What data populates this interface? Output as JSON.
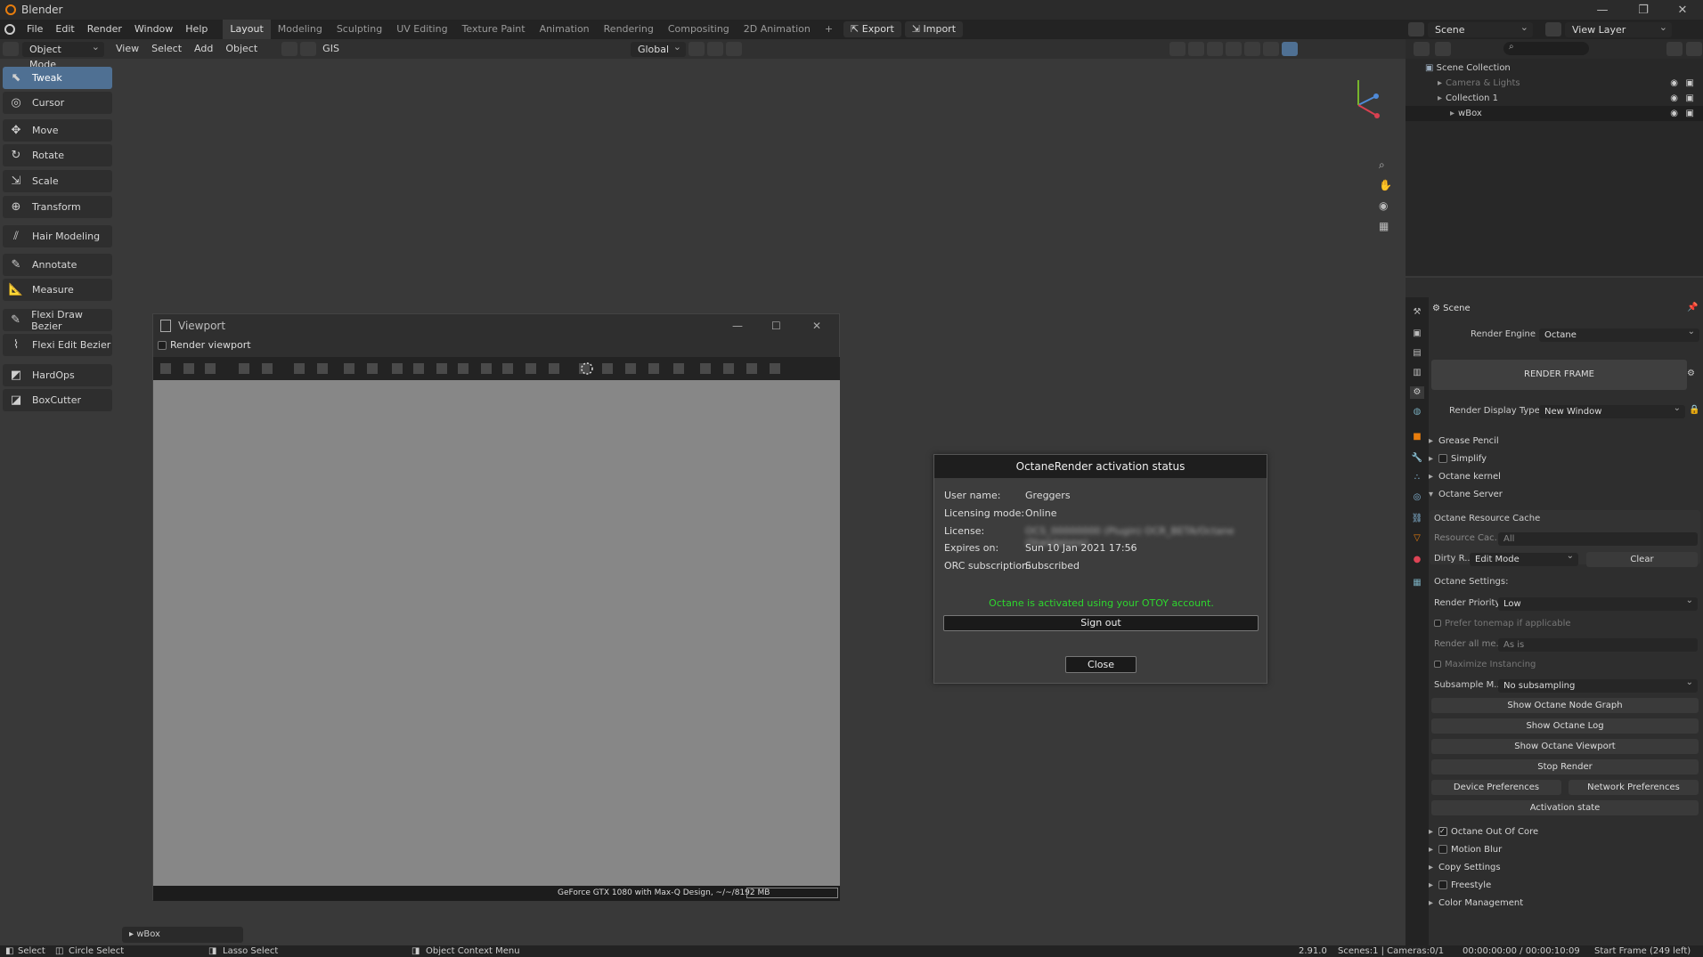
{
  "window": {
    "title": "Blender",
    "min": "—",
    "max": "❐",
    "close": "✕"
  },
  "menus": [
    "File",
    "Edit",
    "Render",
    "Window",
    "Help"
  ],
  "workspaces": [
    "Layout",
    "Modeling",
    "Sculpting",
    "UV Editing",
    "Texture Paint",
    "Animation",
    "Rendering",
    "Compositing",
    "2D Animation"
  ],
  "active_workspace": "Layout",
  "top_buttons": {
    "add": "+",
    "export": "Export",
    "import": "Import"
  },
  "scene_selector": "Scene",
  "view_layer": "View Layer",
  "viewport_header": {
    "mode": "Object Mode",
    "menus": [
      "View",
      "Select",
      "Add",
      "Object"
    ],
    "gis": "GIS",
    "transform_orientation": "Global"
  },
  "tools": [
    {
      "label": "Tweak",
      "icon": "tweak-icon",
      "glyph": "⬉",
      "active": true
    },
    {
      "label": "Cursor",
      "icon": "cursor-icon",
      "glyph": "◎"
    },
    {
      "label": "Move",
      "icon": "move-icon",
      "glyph": "✥"
    },
    {
      "label": "Rotate",
      "icon": "rotate-icon",
      "glyph": "↻"
    },
    {
      "label": "Scale",
      "icon": "scale-icon",
      "glyph": "⇲"
    },
    {
      "label": "Transform",
      "icon": "transform-icon",
      "glyph": "⊕"
    },
    {
      "label": "Hair Modeling",
      "icon": "hair-icon",
      "glyph": "⫽"
    },
    {
      "label": "Annotate",
      "icon": "annotate-icon",
      "glyph": "✎"
    },
    {
      "label": "Measure",
      "icon": "measure-icon",
      "glyph": "📐"
    },
    {
      "label": "Flexi Draw Bezier",
      "icon": "bezier-draw-icon",
      "glyph": "✎"
    },
    {
      "label": "Flexi Edit Bezier",
      "icon": "bezier-edit-icon",
      "glyph": "⌇"
    },
    {
      "label": "HardOps",
      "icon": "hardops-icon",
      "glyph": "◩"
    },
    {
      "label": "BoxCutter",
      "icon": "boxcutter-icon",
      "glyph": "◪"
    }
  ],
  "viewport_window": {
    "title": "Viewport",
    "render_checkbox_label": "Render viewport",
    "gpu_status": "GeForce GTX 1080 with Max-Q Design, ~/~/8192 MB"
  },
  "activation_dialog": {
    "title": "OctaneRender activation status",
    "rows": [
      {
        "label": "User name:",
        "value": "Greggers"
      },
      {
        "label": "Licensing mode:",
        "value": "Online"
      },
      {
        "label": "License:",
        "value": "OCS_00000000 (Plugin) OCR_BETA/Octane (Standalone)"
      },
      {
        "label": "Expires on:",
        "value": "Sun 10 Jan 2021 17:56"
      },
      {
        "label": "ORC subscription:",
        "value": "Subscribed"
      }
    ],
    "status_message": "Octane is activated using your OTOY account.",
    "status_color": "#2ed62e",
    "sign_out": "Sign out",
    "close": "Close"
  },
  "outliner": {
    "root": "Scene Collection",
    "items": [
      {
        "label": "Camera & Lights",
        "indent": 1,
        "dim": true
      },
      {
        "label": "Collection 1",
        "indent": 1
      },
      {
        "label": "wBox",
        "indent": 2,
        "selected": true
      }
    ]
  },
  "properties": {
    "context": "Scene",
    "render_engine_label": "Render Engine",
    "render_engine": "Octane",
    "render_frame": "RENDER FRAME",
    "render_display_type_label": "Render Display Type",
    "render_display_type": "New Window",
    "panels_top": [
      {
        "label": "Grease Pencil",
        "open": false,
        "checkbox": false
      },
      {
        "label": "Simplify",
        "open": false,
        "checkbox": true,
        "checked": false
      },
      {
        "label": "Octane kernel",
        "open": false,
        "checkbox": false
      },
      {
        "label": "Octane Server",
        "open": true,
        "checkbox": false
      }
    ],
    "resource_cache": {
      "title": "Octane Resource Cache",
      "resource_label": "Resource Cac...",
      "resource_value": "All",
      "dirty_label": "Dirty R...",
      "dirty_value": "Edit Mode",
      "clear": "Clear"
    },
    "octane_settings": {
      "title": "Octane Settings:",
      "priority_label": "Render Priority:",
      "priority_value": "Low",
      "prefer_tonemap": "Prefer tonemap if applicable",
      "render_all_label": "Render all me...",
      "render_all_value": "As is",
      "maximize_instancing": "Maximize Instancing",
      "subsample_label": "Subsample M...",
      "subsample_value": "No subsampling"
    },
    "buttons": [
      "Show Octane Node Graph",
      "Show Octane Log",
      "Show Octane Viewport",
      "Stop Render"
    ],
    "device_prefs": "Device Preferences",
    "network_prefs": "Network Preferences",
    "activation_state": "Activation state",
    "panels_bottom": [
      {
        "label": "Octane Out Of Core",
        "checkbox": true,
        "checked": true
      },
      {
        "label": "Motion Blur",
        "checkbox": true,
        "checked": false
      },
      {
        "label": "Copy Settings",
        "checkbox": false
      },
      {
        "label": "Freestyle",
        "checkbox": true,
        "checked": false
      },
      {
        "label": "Color Management",
        "checkbox": false
      }
    ]
  },
  "last_operator": "wBox",
  "statusbar": {
    "select": "Select",
    "circle_select": "Circle Select",
    "lasso_select": "Lasso Select",
    "context_menu": "Object Context Menu",
    "version": "2.91.0",
    "scenes": "Scenes:1 | Cameras:0/1",
    "time": "00:00:00:00 / 00:00:10:09",
    "start_frame": "Start Frame (249 left)"
  }
}
